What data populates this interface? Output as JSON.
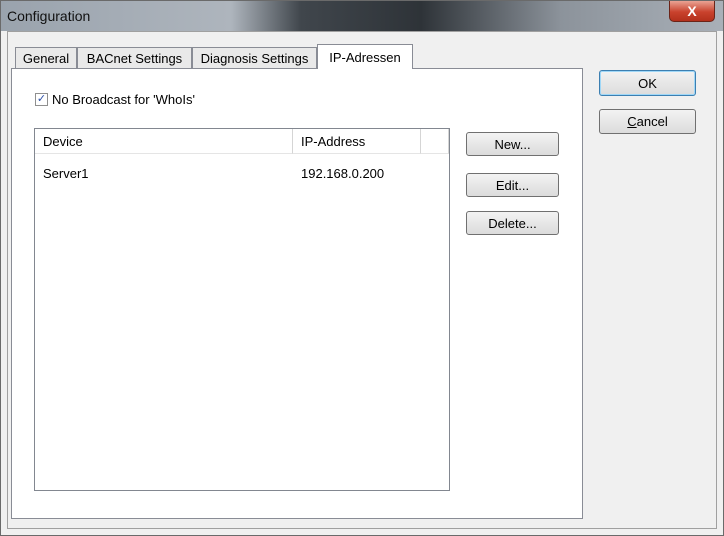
{
  "window": {
    "title": "Configuration",
    "close_glyph": "X"
  },
  "tabs": [
    {
      "label": "General"
    },
    {
      "label": "BACnet Settings"
    },
    {
      "label": "Diagnosis Settings"
    },
    {
      "label": "IP-Adressen",
      "active": true
    }
  ],
  "checkbox": {
    "label": "No Broadcast for 'WhoIs'",
    "checked": true,
    "check_glyph": "✓"
  },
  "list": {
    "columns": [
      "Device",
      "IP-Address"
    ],
    "rows": [
      {
        "device": "Server1",
        "ip": "192.168.0.200"
      }
    ]
  },
  "list_buttons": {
    "new": "New...",
    "edit": "Edit...",
    "delete": "Delete..."
  },
  "dialog_buttons": {
    "ok": "OK",
    "cancel_mnemonic": "C",
    "cancel_rest": "ancel"
  }
}
